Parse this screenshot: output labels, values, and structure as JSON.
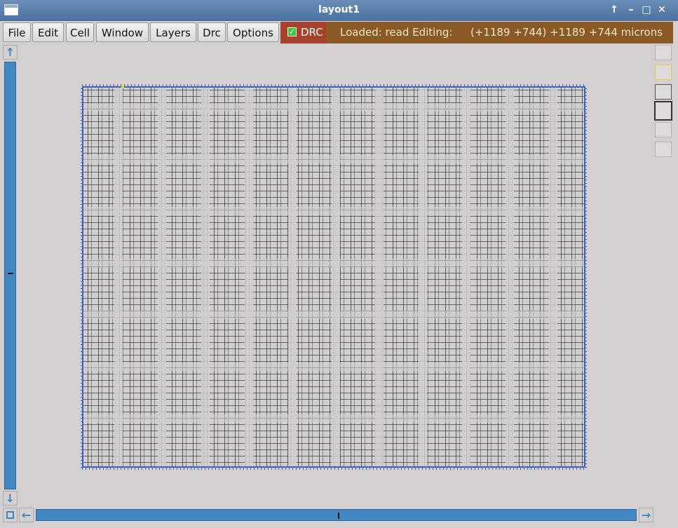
{
  "window": {
    "title": "layout1",
    "controls": {
      "help": "↑",
      "minimize": "–",
      "maximize": "□",
      "close": "✕"
    }
  },
  "menubar": {
    "items": [
      "File",
      "Edit",
      "Cell",
      "Window",
      "Layers",
      "Drc",
      "Options"
    ],
    "drc_label": "DRC",
    "drc_checked": true
  },
  "status": {
    "loaded": "Loaded: read Editing:",
    "coords": "(+1189 +744) +1189 +744 microns"
  },
  "icons": {
    "window_icon": "window-icon",
    "scroll_up": "↑",
    "scroll_down": "↓",
    "scroll_left": "←",
    "scroll_right": "→",
    "check": "✓"
  },
  "colors": {
    "titlebar": "#4a72a0",
    "drc_bg": "#a8422c",
    "status_bg": "#8b5a24",
    "scroll_track": "#4187c2",
    "boundary": "#3c63c4",
    "canvas_bg": "#d4d0d2"
  }
}
